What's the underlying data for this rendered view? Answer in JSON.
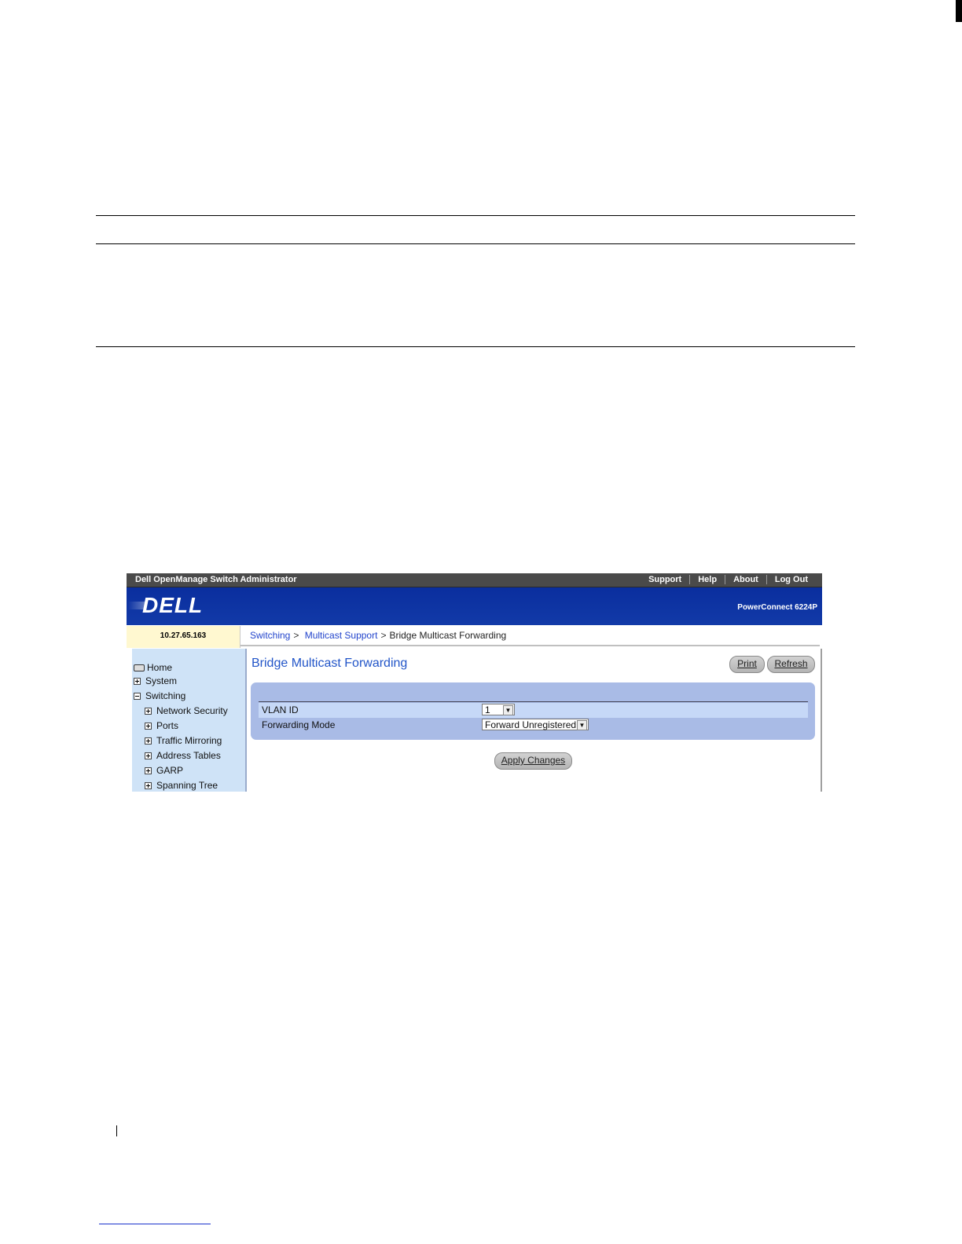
{
  "window": {
    "app_title": "Dell OpenManage Switch Administrator",
    "top_links": [
      "Support",
      "Help",
      "About",
      "Log Out"
    ],
    "brand": "DELL",
    "model": "PowerConnect 6224P",
    "ip_address": "10.27.65.163"
  },
  "breadcrumb": {
    "items": [
      "Switching",
      "Multicast Support"
    ],
    "separator": ">",
    "current": "Bridge Multicast Forwarding"
  },
  "sidebar": {
    "items": [
      {
        "label": "Home",
        "icon": "home-icon"
      },
      {
        "label": "System",
        "icon": "expand-icon"
      },
      {
        "label": "Switching",
        "icon": "collapse-icon"
      },
      {
        "label": "Network Security",
        "icon": "expand-icon"
      },
      {
        "label": "Ports",
        "icon": "expand-icon"
      },
      {
        "label": "Traffic Mirroring",
        "icon": "expand-icon"
      },
      {
        "label": "Address Tables",
        "icon": "expand-icon"
      },
      {
        "label": "GARP",
        "icon": "expand-icon"
      },
      {
        "label": "Spanning Tree",
        "icon": "expand-icon"
      }
    ]
  },
  "main": {
    "title": "Bridge Multicast Forwarding",
    "print_label": "Print",
    "refresh_label": "Refresh",
    "fields": {
      "vlan_id_label": "VLAN ID",
      "vlan_id_value": "1",
      "forwarding_mode_label": "Forwarding Mode",
      "forwarding_mode_value": "Forward Unregistered"
    },
    "apply_label": "Apply Changes"
  },
  "colors": {
    "banner": "#0a2e9e",
    "title_blue": "#2255c8",
    "panel": "#a9bbe6",
    "sidebar": "#cfe3f7",
    "ip_box": "#fff8d0"
  }
}
